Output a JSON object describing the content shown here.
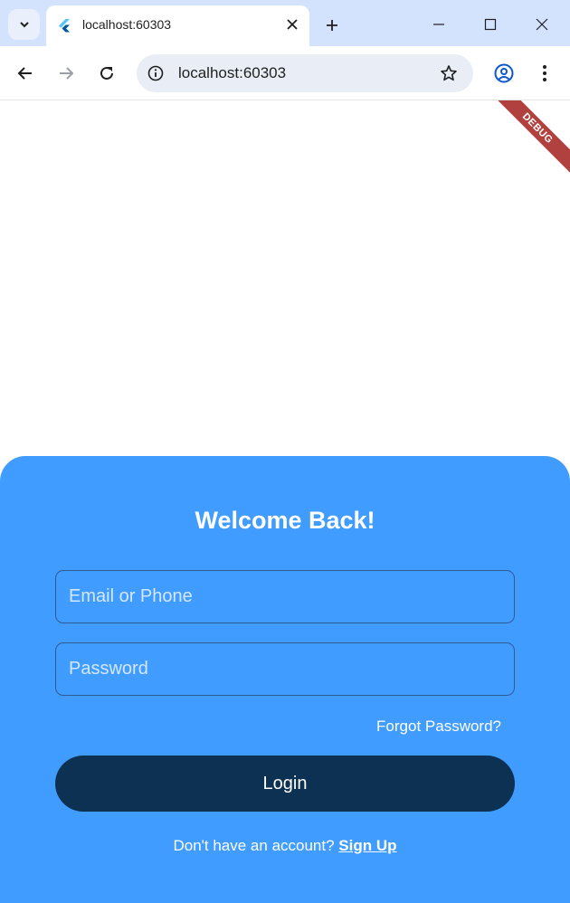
{
  "browser": {
    "tab": {
      "title": "localhost:60303",
      "favicon": "flutter-icon"
    },
    "address_bar": {
      "url": "localhost:60303"
    }
  },
  "app": {
    "debug_banner": "DEBUG",
    "title": "Welcome Back!",
    "email_field": {
      "placeholder": "Email or Phone",
      "value": ""
    },
    "password_field": {
      "placeholder": "Password",
      "value": ""
    },
    "forgot_password_label": "Forgot Password?",
    "login_label": "Login",
    "signup_prompt": "Don't have an account? ",
    "signup_link": "Sign Up",
    "colors": {
      "sheet": "#409cff",
      "login_button": "#0d3152",
      "field_border": "#2d5b94",
      "debug_banner": "#b0413e"
    }
  }
}
